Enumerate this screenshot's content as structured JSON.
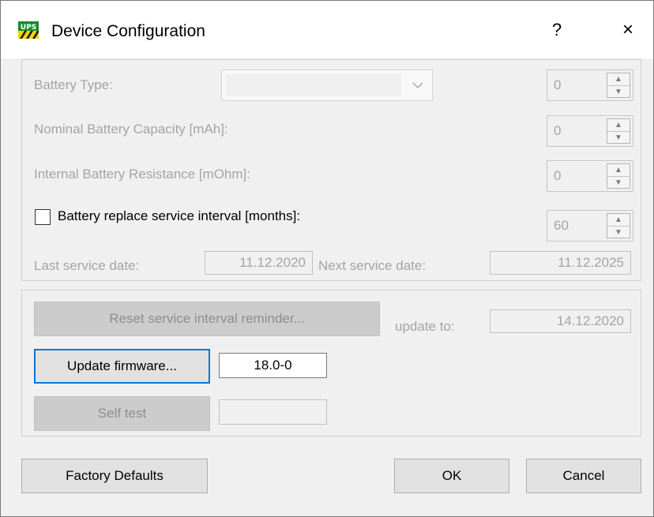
{
  "window": {
    "title": "Device Configuration",
    "help_label": "?",
    "close_label": "×",
    "app_icon_text": "UPS"
  },
  "battery": {
    "type_label": "Battery Type:",
    "type_value": "",
    "type_spin": "0",
    "capacity_label": "Nominal Battery Capacity [mAh]:",
    "capacity_value": "0",
    "resistance_label": "Internal Battery Resistance [mOhm]:",
    "resistance_value": "0",
    "replace_label": "Battery replace service interval [months]:",
    "replace_checked": false,
    "replace_value": "60",
    "last_service_label": "Last service date:",
    "last_service_value": "11.12.2020",
    "next_service_label": "Next service date:",
    "next_service_value": "11.12.2025"
  },
  "actions": {
    "reset_label": "Reset service interval reminder...",
    "update_to_label": "update to:",
    "update_to_value": "14.12.2020",
    "firmware_label": "Update firmware...",
    "firmware_value": "18.0-0",
    "selftest_label": "Self test",
    "selftest_value": ""
  },
  "footer": {
    "factory_label": "Factory Defaults",
    "ok_label": "OK",
    "cancel_label": "Cancel"
  },
  "colors": {
    "accent": "#0078d7",
    "disabled_text": "#a4a4a4"
  },
  "icons": {
    "combo_chevron": "chevron-down-icon",
    "spin_up": "spin-up-icon",
    "spin_down": "spin-down-icon"
  }
}
